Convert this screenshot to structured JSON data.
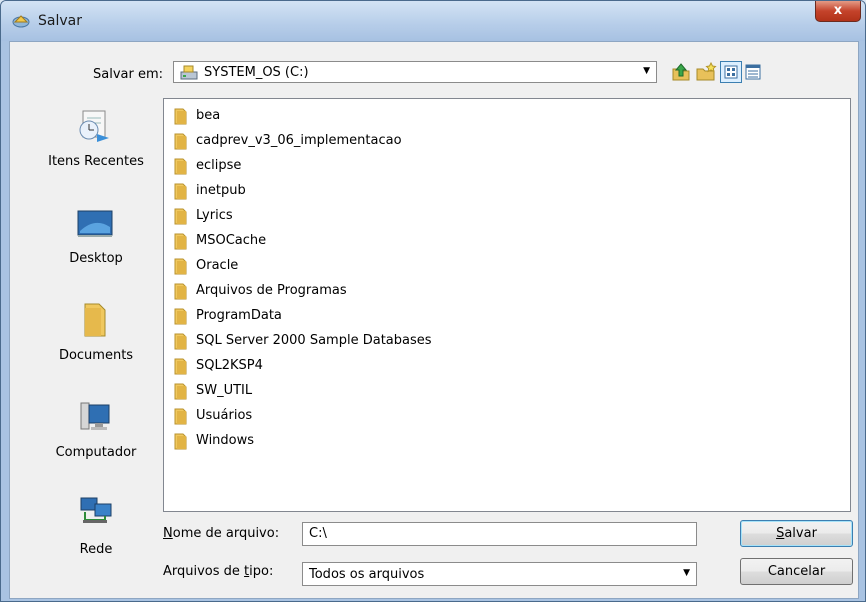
{
  "window": {
    "title": "Salvar",
    "close_label": "x"
  },
  "savein": {
    "label": "Salvar em:",
    "value": "SYSTEM_OS (C:)"
  },
  "places": [
    {
      "label": "Itens Recentes",
      "icon": "recent-items-icon"
    },
    {
      "label": "Desktop",
      "icon": "desktop-icon"
    },
    {
      "label": "Documents",
      "icon": "documents-folder-icon"
    },
    {
      "label": "Computador",
      "icon": "computer-icon"
    },
    {
      "label": "Rede",
      "icon": "network-icon"
    }
  ],
  "files": [
    "bea",
    "cadprev_v3_06_implementacao",
    "eclipse",
    "inetpub",
    "Lyrics",
    "MSOCache",
    "Oracle",
    "Arquivos de Programas",
    "ProgramData",
    "SQL Server 2000 Sample Databases",
    "SQL2KSP4",
    "SW_UTIL",
    "Usuários",
    "Windows"
  ],
  "filename": {
    "label_u": "N",
    "label_rest": "ome de arquivo:",
    "value": "C:\\"
  },
  "filetype": {
    "label_pre": "Arquivos de ",
    "label_u": "t",
    "label_rest": "ipo:",
    "value": "Todos os arquivos"
  },
  "buttons": {
    "save_u": "S",
    "save_rest": "alvar",
    "cancel": "Cancelar"
  },
  "colors": {
    "folder": "#e8c15a",
    "title_bar": "#b6cde9",
    "close": "#c4432b"
  }
}
